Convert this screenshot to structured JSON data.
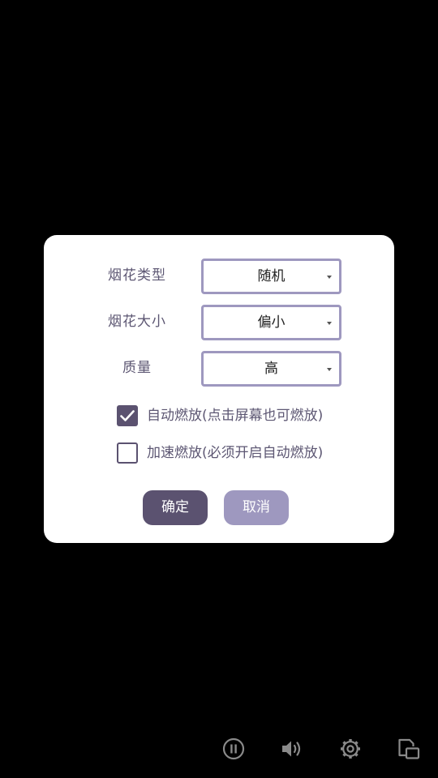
{
  "dialog": {
    "fields": [
      {
        "label": "烟花类型",
        "value": "随机"
      },
      {
        "label": "烟花大小",
        "value": "偏小"
      },
      {
        "label": "质量",
        "value": "高"
      }
    ],
    "options": [
      {
        "label": "自动燃放(点击屏幕也可燃放)",
        "checked": true
      },
      {
        "label": "加速燃放(必须开启自动燃放)",
        "checked": false
      }
    ],
    "confirm_label": "确定",
    "cancel_label": "取消"
  },
  "toolbar": {
    "icons": [
      "pause-icon",
      "volume-icon",
      "settings-gear-icon",
      "layout-switch-icon"
    ]
  },
  "colors": {
    "background": "#000000",
    "dialog": "#ffffff",
    "accent_dark": "#5b5270",
    "accent_light": "#9e98bf",
    "label_text": "#5d5773",
    "icon_gray": "#8a8a8a"
  }
}
